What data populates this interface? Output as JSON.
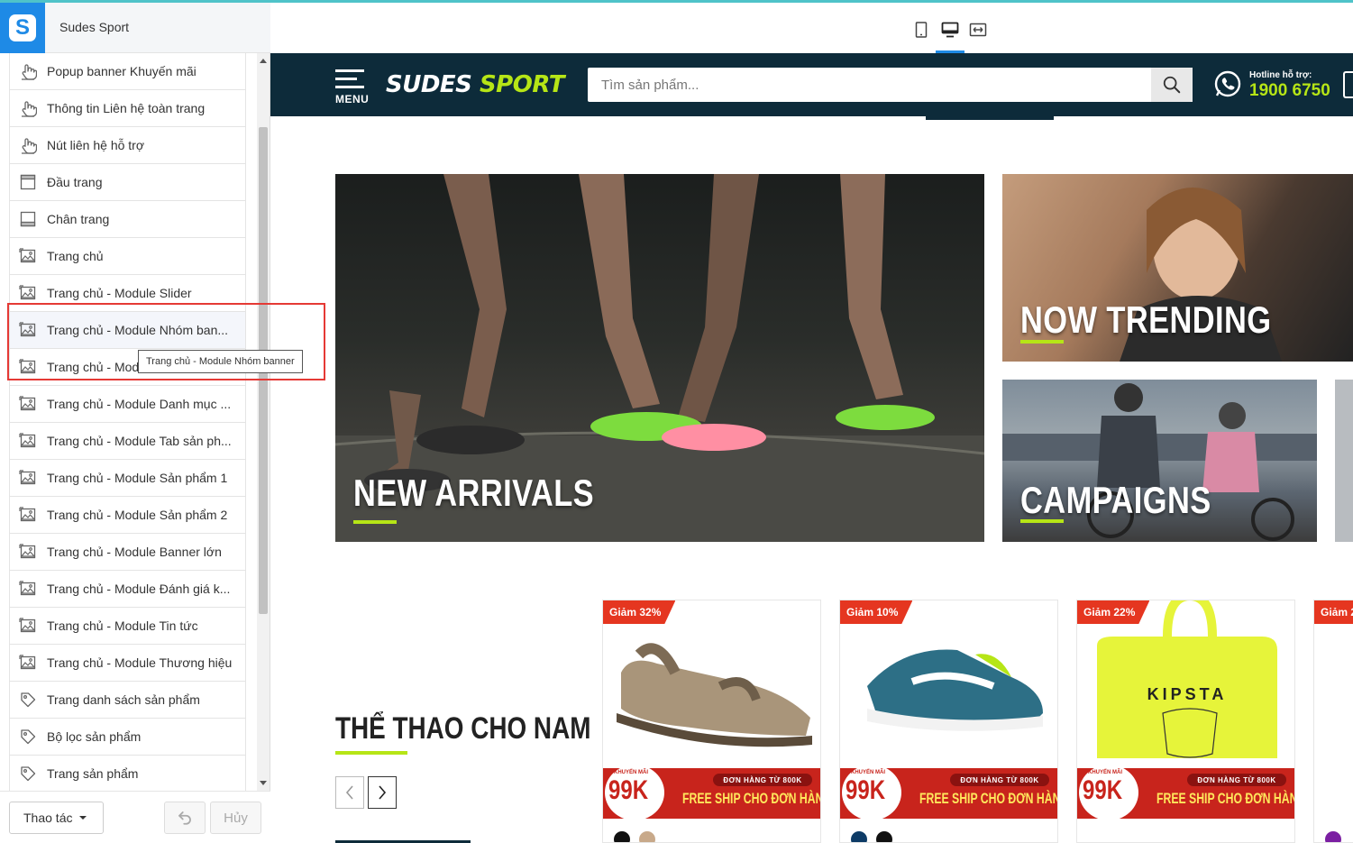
{
  "app": {
    "title": "Sudes Sport",
    "logo_letter": "S"
  },
  "sidebar": {
    "items": [
      {
        "label": "Popup banner Khuyến mãi",
        "icon": "pointer-hand-icon"
      },
      {
        "label": "Thông tin Liên hệ toàn trang",
        "icon": "pointer-hand-icon"
      },
      {
        "label": "Nút liên hệ hỗ trợ",
        "icon": "pointer-hand-icon"
      },
      {
        "label": "Đầu trang",
        "icon": "page-header-icon"
      },
      {
        "label": "Chân trang",
        "icon": "page-footer-icon"
      },
      {
        "label": "Trang chủ",
        "icon": "image-template-icon"
      },
      {
        "label": "Trang chủ - Module Slider",
        "icon": "image-template-icon"
      },
      {
        "label": "Trang chủ - Module Nhóm ban...",
        "icon": "image-template-icon"
      },
      {
        "label": "Trang chủ - Mod",
        "icon": "image-template-icon"
      },
      {
        "label": "Trang chủ - Module Danh mục ...",
        "icon": "image-template-icon"
      },
      {
        "label": "Trang chủ - Module Tab sản ph...",
        "icon": "image-template-icon"
      },
      {
        "label": "Trang chủ - Module Sản phẩm 1",
        "icon": "image-template-icon"
      },
      {
        "label": "Trang chủ - Module Sản phẩm 2",
        "icon": "image-template-icon"
      },
      {
        "label": "Trang chủ - Module Banner lớn",
        "icon": "image-template-icon"
      },
      {
        "label": "Trang chủ - Module Đánh giá k...",
        "icon": "image-template-icon"
      },
      {
        "label": "Trang chủ - Module Tin tức",
        "icon": "image-template-icon"
      },
      {
        "label": "Trang chủ - Module Thương hiệu",
        "icon": "image-template-icon"
      },
      {
        "label": "Trang danh sách sản phẩm",
        "icon": "tag-icon"
      },
      {
        "label": "Bộ lọc sản phẩm",
        "icon": "tag-icon"
      },
      {
        "label": "Trang sản phẩm",
        "icon": "tag-icon"
      }
    ],
    "active_index": 7,
    "tooltip": "Trang chủ - Module Nhóm banner"
  },
  "footer": {
    "actions_label": "Thao tác",
    "cancel_label": "Hủy"
  },
  "device_toolbar": {
    "devices": [
      "mobile-icon",
      "desktop-icon",
      "fullwidth-icon"
    ],
    "active": "desktop-icon"
  },
  "site": {
    "menu_label": "MENU",
    "logo_part1": "SUDES",
    "logo_part2": " SPORT",
    "search_placeholder": "Tìm sản phẩm...",
    "hotline_label": "Hotline hỗ trợ:",
    "hotline_number": "1900 6750",
    "banners": {
      "main": "NEW ARRIVALS",
      "trend": "NOW TRENDING",
      "campaign": "CAMPAIGNS"
    },
    "section_title": "THỂ THAO CHO NAM",
    "products": [
      {
        "discount": "Giảm 32%",
        "swatches": [
          "#111111",
          "#c8a98a"
        ]
      },
      {
        "discount": "Giảm 10%",
        "swatches": [
          "#0d3b66",
          "#111111"
        ]
      },
      {
        "discount": "Giảm 22%",
        "swatches": []
      },
      {
        "discount": "Giảm 2",
        "swatches": [
          "#7b1fa2"
        ]
      }
    ],
    "promo": {
      "small": "KHUYẾN MÃI",
      "price": "99K",
      "pill": "ĐƠN HÀNG TỪ 800K",
      "ship": "FREE SHIP CHO ĐƠN HÀNG"
    },
    "colors": {
      "header_bg": "#0d2b3a",
      "accent": "#b6e516",
      "discount_red": "#e53620",
      "editor_blue": "#1e8ae6"
    }
  }
}
